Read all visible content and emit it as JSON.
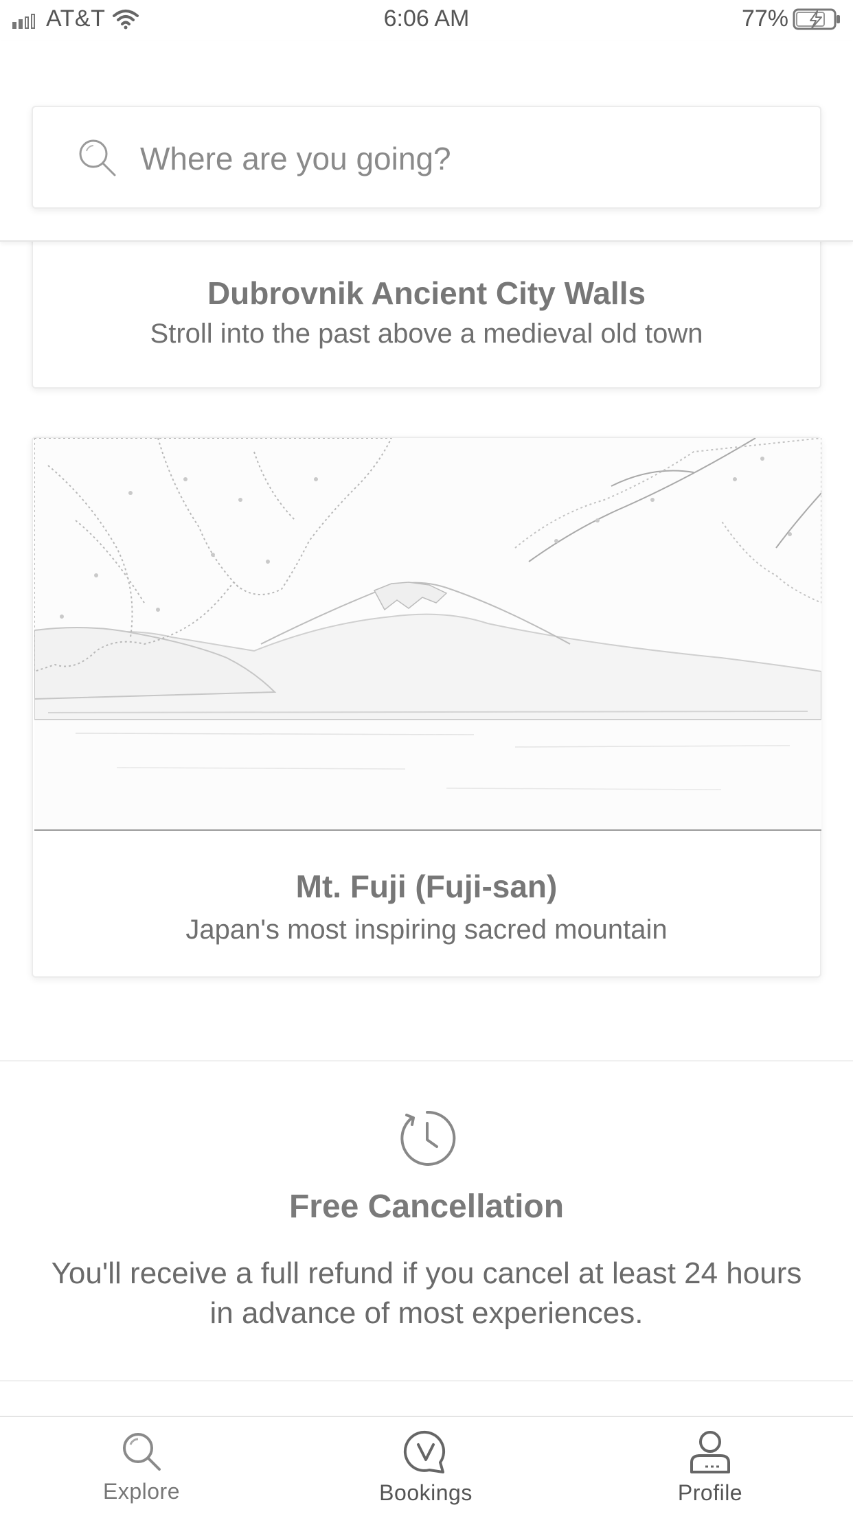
{
  "status_bar": {
    "carrier": "AT&T",
    "time": "6:06 AM",
    "battery": "77%"
  },
  "search": {
    "placeholder": "Where are you going?"
  },
  "cards": [
    {
      "title": "Dubrovnik Ancient City Walls",
      "subtitle": "Stroll into the past above a medieval old town"
    },
    {
      "title": "Mt. Fuji (Fuji-san)",
      "subtitle": "Japan's most inspiring sacred mountain",
      "image": "mount-fuji-photo"
    }
  ],
  "free_cancellation": {
    "icon": "clock-refresh-icon",
    "title": "Free Cancellation",
    "text": "You'll receive a full refund if you cancel at least 24 hours in advance of most experiences."
  },
  "tab_bar": {
    "tabs": [
      {
        "label": "Explore",
        "icon": "search-icon"
      },
      {
        "label": "Bookings",
        "icon": "bookings-icon"
      },
      {
        "label": "Profile",
        "icon": "profile-icon"
      }
    ]
  }
}
